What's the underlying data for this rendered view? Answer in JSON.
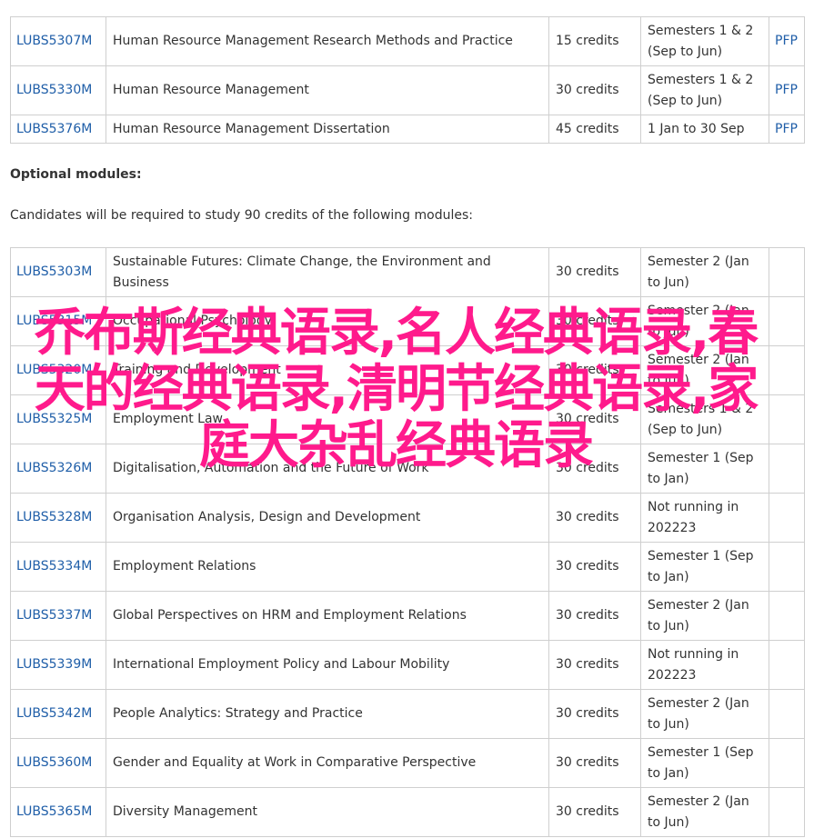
{
  "core_modules": [
    {
      "code": "LUBS5307M",
      "title": "Human Resource Management Research Methods and Practice",
      "credits": "15 credits",
      "period": "Semesters 1 & 2 (Sep to Jun)",
      "spec": "PFP"
    },
    {
      "code": "LUBS5330M",
      "title": "Human Resource Management",
      "credits": "30 credits",
      "period": "Semesters 1 & 2 (Sep to Jun)",
      "spec": "PFP"
    },
    {
      "code": "LUBS5376M",
      "title": "Human Resource Management Dissertation",
      "credits": "45 credits",
      "period": "1 Jan to 30 Sep",
      "spec": "PFP"
    }
  ],
  "optional_heading": "Optional modules:",
  "optional_intro": "Candidates will be required to study 90 credits of the following modules:",
  "optional_modules": [
    {
      "code": "LUBS5303M",
      "title": "Sustainable Futures: Climate Change, the Environment and Business",
      "credits": "30 credits",
      "period": "Semester 2 (Jan to Jun)"
    },
    {
      "code": "LUBS5315M",
      "title": "Occupational Psychology",
      "credits": "30 credits",
      "period": "Semester 2 (Jan to Jun)"
    },
    {
      "code": "LUBS5320M",
      "title": "Training and Development",
      "credits": "30 credits",
      "period": "Semester 2 (Jan to Jun)"
    },
    {
      "code": "LUBS5325M",
      "title": "Employment Law",
      "credits": "30 credits",
      "period": "Semesters 1 & 2 (Sep to Jun)"
    },
    {
      "code": "LUBS5326M",
      "title": "Digitalisation, Automation and the Future of Work",
      "credits": "30 credits",
      "period": "Semester 1 (Sep to Jan)"
    },
    {
      "code": "LUBS5328M",
      "title": "Organisation Analysis, Design and Development",
      "credits": "30 credits",
      "period": "Not running in 202223"
    },
    {
      "code": "LUBS5334M",
      "title": "Employment Relations",
      "credits": "30 credits",
      "period": "Semester 1 (Sep to Jan)"
    },
    {
      "code": "LUBS5337M",
      "title": "Global Perspectives on HRM and Employment Relations",
      "credits": "30 credits",
      "period": "Semester 2 (Jan to Jun)"
    },
    {
      "code": "LUBS5339M",
      "title": "International Employment Policy and Labour Mobility",
      "credits": "30 credits",
      "period": "Not running in 202223"
    },
    {
      "code": "LUBS5342M",
      "title": "People Analytics: Strategy and Practice",
      "credits": "30 credits",
      "period": "Semester 2 (Jan to Jun)"
    },
    {
      "code": "LUBS5360M",
      "title": "Gender and Equality at Work in Comparative Perspective",
      "credits": "30 credits",
      "period": "Semester 1 (Sep to Jan)"
    },
    {
      "code": "LUBS5365M",
      "title": "Diversity Management",
      "credits": "30 credits",
      "period": "Semester 2 (Jan to Jun)"
    }
  ],
  "overlay_text": "乔布斯经典语录,名人经典语录,春天的经典语录,清明节经典语录,家庭大杂乱经典语录",
  "colors": {
    "link": "#1f5ea8",
    "text": "#333333",
    "border": "#cfcfcf",
    "overlay": "#ff1a8c"
  }
}
